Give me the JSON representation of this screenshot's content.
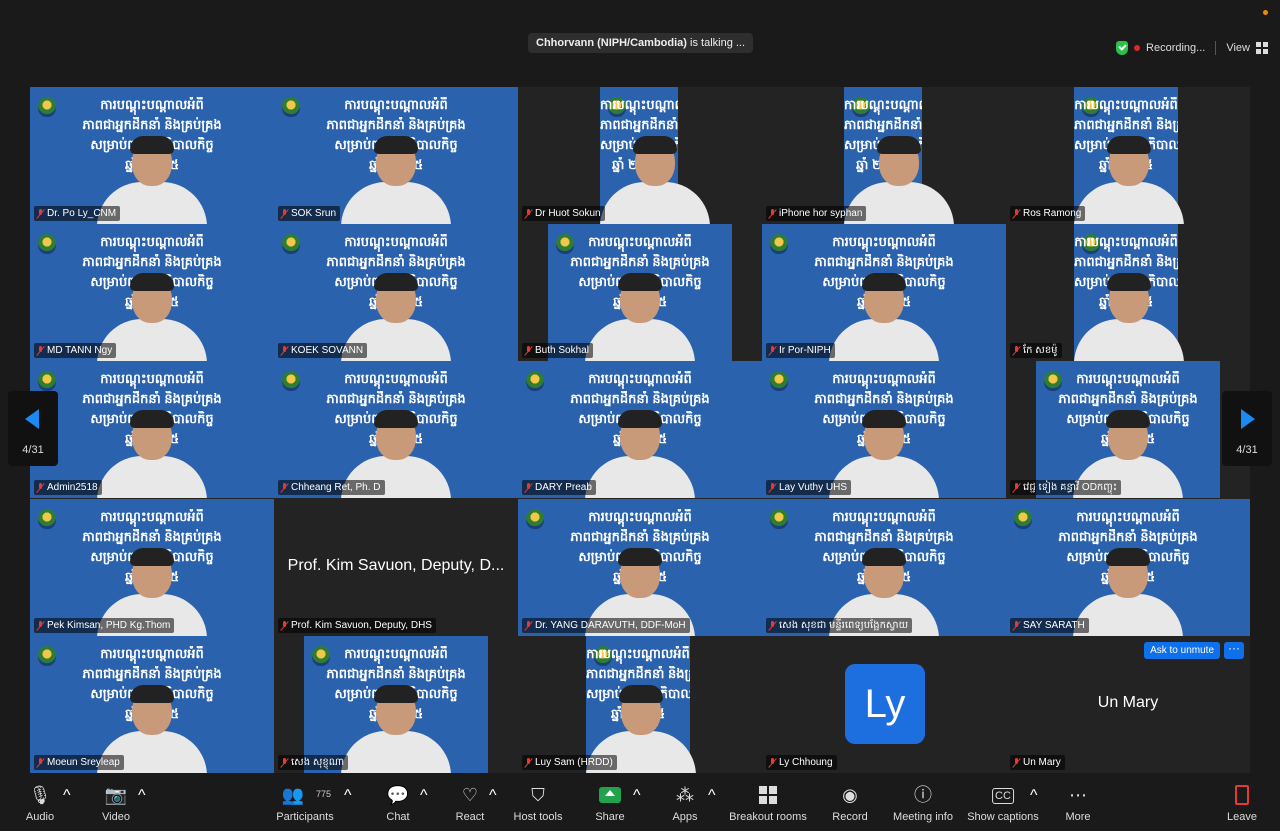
{
  "header": {
    "talking_name": "Chhorvann (NIPH/Cambodia)",
    "talking_suffix": "is talking ...",
    "recording_label": "Recording...",
    "view_label": "View"
  },
  "slide_text": {
    "line1": "ការបណ្តុះបណ្តាលអំពី",
    "line2": "ភាពជាអ្នកដឹកនាំ និងគ្រប់គ្រង",
    "line3": "សម្រាប់ពង្រឹងអភិបាលកិច្ច",
    "line4": "ឆ្នាំ ២០២៥"
  },
  "tiles": [
    {
      "name": "Dr. Po Ly_CNM"
    },
    {
      "name": "SOK Srun"
    },
    {
      "name": "Dr Huot Sokun"
    },
    {
      "name": "iPhone hor syphan"
    },
    {
      "name": "Ros Ramong"
    },
    {
      "name": "MD TANN Ngy"
    },
    {
      "name": "KOEK SOVANN"
    },
    {
      "name": "Buth Sokhal"
    },
    {
      "name": "Ir Por-NIPH"
    },
    {
      "name": "កែ សខម៉ូ"
    },
    {
      "name": "Admin2518"
    },
    {
      "name": "Chheang Ret, Ph. D"
    },
    {
      "name": "DARY Preab"
    },
    {
      "name": "Lay Vuthy UHS"
    },
    {
      "name": "វេជ្ជ ទៀង គន្ធាវី ODកញ្ចុះ"
    },
    {
      "name": "Pek Kimsan, PHD Kg.Thom"
    },
    {
      "name": "Prof. Kim Savuon, Deputy, DHS",
      "center": "Prof. Kim Savuon, Deputy, D..."
    },
    {
      "name": "Dr. YANG DARAVUTH, DDF-MoH"
    },
    {
      "name": "សេង សុខជា មន្ទីរពេទ្យបង្អែកស្វាយ"
    },
    {
      "name": "SAY SARATH"
    },
    {
      "name": "Moeun Sreyleap"
    },
    {
      "name": "សេង សុខ្ញុណា"
    },
    {
      "name": "Luy Sam (HRDD)"
    },
    {
      "name": "Ly Chhoung",
      "avatar": "Ly"
    },
    {
      "name": "Un Mary",
      "center": "Un Mary",
      "ask_unmute": "Ask to unmute",
      "more": "···"
    }
  ],
  "pager": {
    "left": "4/31",
    "right": "4/31"
  },
  "toolbar": {
    "audio": "Audio",
    "video": "Video",
    "participants": "Participants",
    "participants_count": "775",
    "chat": "Chat",
    "react": "React",
    "host_tools": "Host tools",
    "share": "Share",
    "apps": "Apps",
    "breakout": "Breakout rooms",
    "record": "Record",
    "meeting_info": "Meeting info",
    "captions": "Show captions",
    "more": "More",
    "leave": "Leave"
  }
}
